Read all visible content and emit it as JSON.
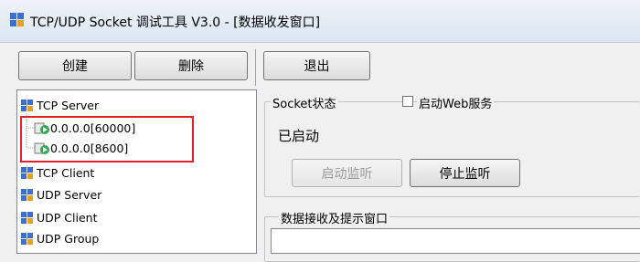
{
  "window": {
    "title": "TCP/UDP Socket 调试工具 V3.0 - [数据收发窗口]"
  },
  "toolbar": {
    "create_label": "创建",
    "delete_label": "删除",
    "exit_label": "退出"
  },
  "tree": {
    "tcp_server": {
      "label": "TCP Server",
      "children": [
        "0.0.0.0[60000]",
        "0.0.0.0[8600]"
      ]
    },
    "tcp_client": "TCP Client",
    "udp_server": "UDP Server",
    "udp_client": "UDP Client",
    "udp_group": "UDP Group"
  },
  "socket_panel": {
    "group_label": "Socket状态",
    "web_service_label": "启动Web服务",
    "web_service_checked": false,
    "status_text": "已启动",
    "start_listen_label": "启动监听",
    "stop_listen_label": "停止监听"
  },
  "recv_panel": {
    "group_label": "数据接收及提示窗口"
  },
  "colors": {
    "highlight": "#e0202a",
    "icon_blue": "#3b6fd1",
    "icon_orange": "#e8a020"
  }
}
